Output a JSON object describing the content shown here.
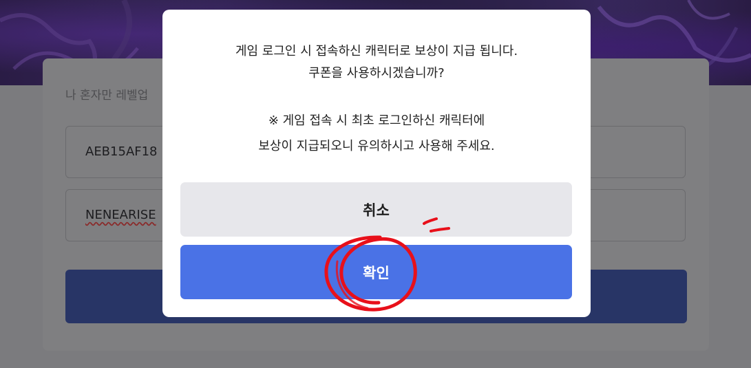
{
  "background": {
    "description_text": "나 혼자만 레벨업",
    "coupon_field_value": "AEB15AF18",
    "second_field_value": "NENEARISE"
  },
  "modal": {
    "message_line1": "게임 로그인 시 접속하신 캐릭터로 보상이 지급 됩니다.",
    "message_line2": "쿠폰을 사용하시겠습니까?",
    "notice_line1": "※ 게임 접속 시 최초 로그인하신 캐릭터에",
    "notice_line2": "보상이 지급되오니 유의하시고 사용해 주세요.",
    "cancel_label": "취소",
    "confirm_label": "확인"
  },
  "colors": {
    "confirm_button": "#4a72e6",
    "cancel_button": "#e7e7eb",
    "annotation": "#e8101a",
    "overlay": "#7b7b7e"
  }
}
